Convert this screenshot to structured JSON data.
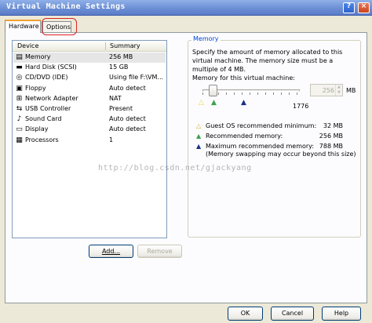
{
  "window": {
    "title": "Virtual Machine Settings",
    "help_glyph": "?",
    "close_glyph": "×"
  },
  "tabs": [
    {
      "label": "Hardware",
      "active": true
    },
    {
      "label": "Options",
      "active": false
    }
  ],
  "device_list": {
    "columns": [
      "Device",
      "Summary"
    ],
    "rows": [
      {
        "icon": "memory-icon",
        "glyph": "▤",
        "device": "Memory",
        "summary": "256 MB",
        "selected": true
      },
      {
        "icon": "hard-disk-icon",
        "glyph": "▬",
        "device": "Hard Disk (SCSI)",
        "summary": "15 GB"
      },
      {
        "icon": "cd-dvd-icon",
        "glyph": "◎",
        "device": "CD/DVD (IDE)",
        "summary": "Using file F:\\VM..."
      },
      {
        "icon": "floppy-icon",
        "glyph": "▣",
        "device": "Floppy",
        "summary": "Auto detect"
      },
      {
        "icon": "network-adapter-icon",
        "glyph": "⊞",
        "device": "Network Adapter",
        "summary": "NAT"
      },
      {
        "icon": "usb-controller-icon",
        "glyph": "⇆",
        "device": "USB Controller",
        "summary": "Present"
      },
      {
        "icon": "sound-card-icon",
        "glyph": "♪",
        "device": "Sound Card",
        "summary": "Auto detect"
      },
      {
        "icon": "display-icon",
        "glyph": "▭",
        "device": "Display",
        "summary": "Auto detect"
      },
      {
        "icon": "processors-icon",
        "glyph": "▦",
        "device": "Processors",
        "summary": "1"
      }
    ]
  },
  "buttons": {
    "add": "Add...",
    "remove": "Remove",
    "ok": "OK",
    "cancel": "Cancel",
    "help": "Help"
  },
  "memory": {
    "group_label": "Memory",
    "description": "Specify the amount of memory allocated to this virtual machine. The memory size must be a multiple of 4 MB.",
    "field_label": "Memory for this virtual machine:",
    "value": "256",
    "unit": "MB",
    "slider_max_label": "1776",
    "slider_fraction": 0.14,
    "legend": [
      {
        "color": "#e8d34a",
        "label": "Guest OS recommended minimum:",
        "value": "32 MB"
      },
      {
        "color": "#3aa34a",
        "label": "Recommended memory:",
        "value": "256 MB"
      },
      {
        "color": "#1a2d8a",
        "label": "Maximum recommended memory:",
        "value": "788 MB"
      }
    ],
    "note": "(Memory swapping may occur beyond this size)"
  },
  "watermark": "http://blog.csdn.net/gjackyang"
}
